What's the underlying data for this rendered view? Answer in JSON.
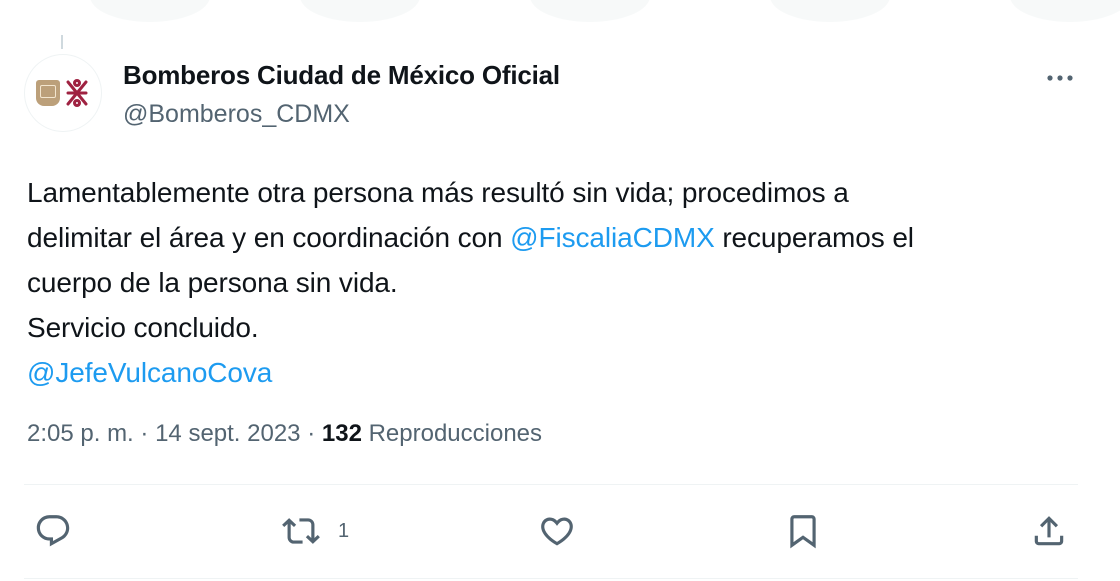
{
  "tweet": {
    "author": {
      "display_name": "Bomberos Ciudad de México Oficial",
      "handle": "@Bomberos_CDMX",
      "avatar_icon": "cdmx-logo"
    },
    "text_lines": [
      [
        {
          "text": "Lamentablemente otra persona más resultó sin vida; procedimos a",
          "mention": false
        }
      ],
      [
        {
          "text": "delimitar el área y en coordinación con ",
          "mention": false
        },
        {
          "text": "@FiscaliaCDMX",
          "mention": true
        },
        {
          "text": " recuperamos el",
          "mention": false
        }
      ],
      [
        {
          "text": "cuerpo de la persona sin vida.",
          "mention": false
        }
      ],
      [
        {
          "text": "Servicio concluido.",
          "mention": false
        }
      ],
      [
        {
          "text": "@JefeVulcanoCova",
          "mention": true
        }
      ]
    ],
    "meta": {
      "time": "2:05 p. m.",
      "separator": "·",
      "date": "14 sept. 2023",
      "views_count": "132",
      "views_label": "Reproducciones"
    },
    "actions": {
      "reply": {
        "icon": "reply-icon",
        "count": ""
      },
      "retweet": {
        "icon": "retweet-icon",
        "count": "1"
      },
      "like": {
        "icon": "heart-icon",
        "count": ""
      },
      "bookmark": {
        "icon": "bookmark-icon",
        "count": ""
      },
      "share": {
        "icon": "share-icon",
        "count": ""
      }
    }
  },
  "colors": {
    "text": "#0f1419",
    "secondary": "#536471",
    "link": "#1d9bf0",
    "divider": "#eff3f4"
  }
}
